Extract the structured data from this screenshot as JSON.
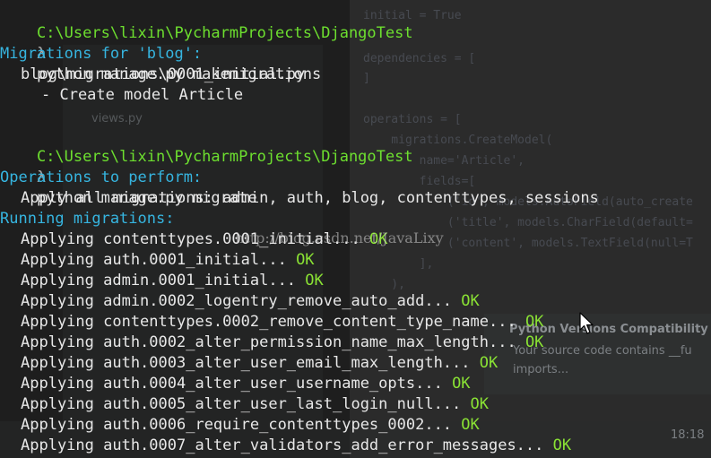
{
  "terminal": {
    "prompt_path": "C:\\Users\\lixin\\PycharmProjects\\DjangoTest",
    "prompt_symbol": "λ",
    "cmd_makemigrations": "python manage.py makemigrations",
    "migrations_for": "Migrations for 'blog':",
    "migration_file": "blog\\migrations\\0001_initial.py",
    "create_model": "- Create model Article",
    "cmd_migrate": "python manage.py migrate",
    "operations_heading": "Operations to perform:",
    "apply_all": "Apply all migrations: admin, auth, blog, contenttypes, sessions",
    "running_heading": "Running migrations:",
    "ok_label": "OK",
    "applying": [
      "Applying contenttypes.0001_initial...",
      "Applying auth.0001_initial...",
      "Applying admin.0001_initial...",
      "Applying admin.0002_logentry_remove_auto_add...",
      "Applying contenttypes.0002_remove_content_type_name...",
      "Applying auth.0002_alter_permission_name_max_length...",
      "Applying auth.0003_alter_user_email_max_length...",
      "Applying auth.0004_alter_user_username_opts...",
      "Applying auth.0005_alter_user_last_login_null...",
      "Applying auth.0006_require_contenttypes_0002...",
      "Applying auth.0007_alter_validators_add_error_messages..."
    ]
  },
  "watermark": "http://blog.csdn.net/JavaLixy",
  "background_ide": {
    "code_lines": [
      "initial = True",
      "dependencies = [",
      "]",
      "operations = [",
      "    migrations.CreateModel(",
      "        name='Article',",
      "        fields=[",
      "            ('id', models.AutoField(auto_create",
      "            ('title', models.CharField(default=",
      "            ('content', models.TextField(null=T",
      "        ],",
      "    ),"
    ],
    "tree_items": [
      "views.py"
    ],
    "popup_title": "Python Versions Compatibility",
    "popup_line1": "Your source code contains __fu",
    "popup_line2": "imports...",
    "status_time": "18:18"
  },
  "colors": {
    "path": "#6ddf2f",
    "heading": "#36b5e0",
    "ok": "#8ae234",
    "text": "#e8e8e8"
  }
}
